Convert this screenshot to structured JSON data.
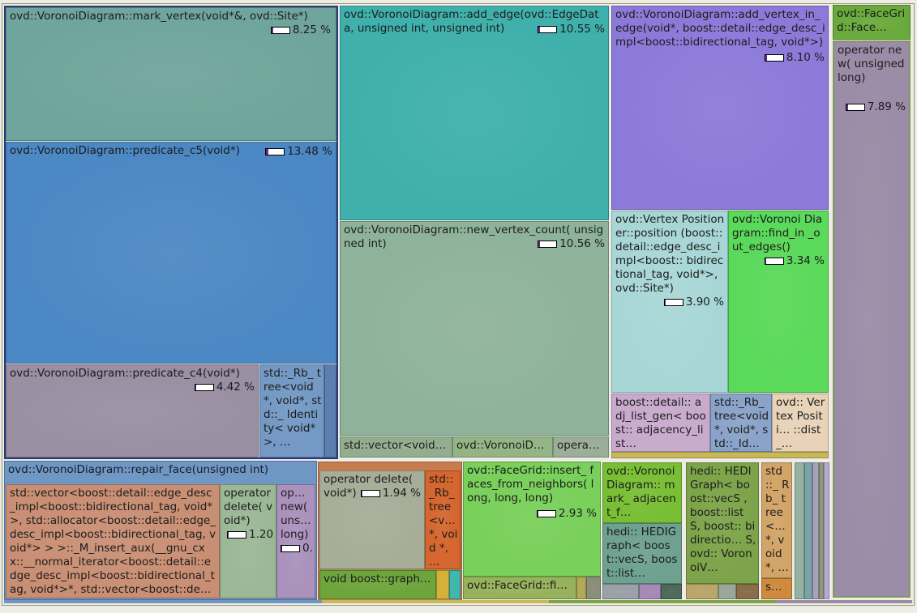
{
  "cells": [
    {
      "id": "mark_vertex",
      "label": "ovd::VoronoiDiagram::mark_vertex(void*&, ovd::Site*)",
      "pct": "8.25 %",
      "fill": 0.1,
      "color": "#6fa59c"
    },
    {
      "id": "add_edge",
      "label": "ovd::VoronoiDiagram::add_edge(ovd::EdgeData, unsigned int, unsigned int)",
      "pct": "10.55 %",
      "fill": 0.1,
      "color": "#3fb0ab"
    },
    {
      "id": "add_vertex_in_edge",
      "label": "ovd::VoronoiDiagram::add_vertex_in_edge(void*, boost::detail::edge_desc_impl<boost::bidirectional_tag, void*>)",
      "pct": "8.10 %",
      "fill": 0.1,
      "color": "#8c7ad9"
    },
    {
      "id": "facegrid_top",
      "label": "ovd::FaceGrid::Face…",
      "color": "#6aaa3c"
    },
    {
      "id": "operator_new",
      "label": "operator new( unsigned long)",
      "pct": "7.89 %",
      "fill": 0.1,
      "color": "#9b8ca7"
    },
    {
      "id": "predicate_c5",
      "label": "ovd::VoronoiDiagram::predicate_c5(void*)",
      "pct": "13.48 %",
      "fill": 0.15,
      "color": "#4c88c4"
    },
    {
      "id": "new_vertex_count",
      "label": "ovd::VoronoiDiagram::new_vertex_count( unsigned int)",
      "pct": "10.56 %",
      "fill": 0.1,
      "color": "#8fb39a"
    },
    {
      "id": "vertex_positioner",
      "label": "ovd::Vertex Positioner::position (boost::detail::edge_desc_impl<boost:: bidirectional_tag, void*>, ovd::Site*)",
      "pct": "3.90 %",
      "fill": 0.05,
      "color": "#a8d6d6"
    },
    {
      "id": "find_in_out_edges",
      "label": "ovd::Voronoi Diagram::find_in _out_edges()",
      "pct": "3.34 %",
      "fill": 0.05,
      "color": "#5ad95a"
    },
    {
      "id": "predicate_c4",
      "label": "ovd::VoronoiDiagram::predicate_c4(void*)",
      "pct": "4.42 %",
      "fill": 0.05,
      "color": "#9a8fa3"
    },
    {
      "id": "rb_tree_left",
      "label": "std::_Rb_ tree<void *, void*, std::_ Identity< void*>, …",
      "color": "#7399c4"
    },
    {
      "id": "adj_list_gen",
      "label": "boost::detail:: adj_list_gen< boost:: adjacency_list…",
      "color": "#c8aacd"
    },
    {
      "id": "rb_tree_mid",
      "label": "std::_Rb_ tree<void *, void*, std::_Id…",
      "color": "#8aa3c8"
    },
    {
      "id": "vertex_positioner_dist",
      "label": "ovd:: Vertex Positi… ::dist_…",
      "color": "#e8d3b8"
    },
    {
      "id": "vector_void",
      "label": "std::vector<void…",
      "color": "#93ae8e"
    },
    {
      "id": "voronoi_d",
      "label": "ovd::VoronoiD…",
      "color": "#93b585"
    },
    {
      "id": "opera",
      "label": "opera…",
      "color": "#9bae98"
    },
    {
      "id": "repair_face",
      "label": "ovd::VoronoiDiagram::repair_face(unsigned int)",
      "color": "#6f97c6"
    },
    {
      "id": "vector_edge_desc",
      "label": "std::vector<boost::detail::edge_desc_impl<boost::bidirectional_tag, void*>, std::allocator<boost::detail::edge_desc_impl<boost::bidirectional_tag, void*> > >::_M_insert_aux(__gnu_cxx::__normal_iterator<boost::detail::edge_desc_impl<boost::bidirectional_tag, void*>*, std::vector<boost::de…",
      "color": "#c98f74"
    },
    {
      "id": "operator_delete_left",
      "label": "operator delete( void*)",
      "pct": "1.20 %",
      "fill": 0.05,
      "color": "#9bb896"
    },
    {
      "id": "op_new_small",
      "label": "op… new( uns… long)",
      "pct": "0.",
      "fill": 0.05,
      "color": "#aa92bd"
    },
    {
      "id": "operator_delete_mid",
      "label": "operator delete( void*)",
      "pct": "1.94 %",
      "fill": 0.05,
      "color": "#a6ad98"
    },
    {
      "id": "rb_tree_orange",
      "label": "std:: _Rb_ tree <v… *, void *, …",
      "color": "#d5662f"
    },
    {
      "id": "void_boost_graph",
      "label": "void boost::graph…",
      "color": "#6da53c"
    },
    {
      "id": "insert_faces",
      "label": "ovd::FaceGrid::insert_ faces_from_neighbors( long, long, long)",
      "pct": "2.93 %",
      "fill": 0.05,
      "color": "#79d05a"
    },
    {
      "id": "facegrid_fi",
      "label": "ovd::FaceGrid::fi…",
      "color": "#98b25c"
    },
    {
      "id": "mark_adjacent",
      "label": "ovd::Voronoi Diagram:: mark_ adjacent_f…",
      "color": "#79bf35"
    },
    {
      "id": "hedi_graph_a",
      "label": "hedi:: HEDIGraph< boost::vecS, boost::list…",
      "color": "#6ea190"
    },
    {
      "id": "hedi_graph_b",
      "label": "hedi:: HEDIGraph< boost::vecS , boost::list S, boost:: bidirectio… S, ovd:: VoronoiV…",
      "color": "#7da44a"
    },
    {
      "id": "std_rb_small",
      "label": "std ::_ Rb_ tree <… *, void *, …",
      "color": "#d2a467"
    },
    {
      "id": "s_small",
      "label": "s…",
      "color": "#cf8a3d"
    }
  ]
}
